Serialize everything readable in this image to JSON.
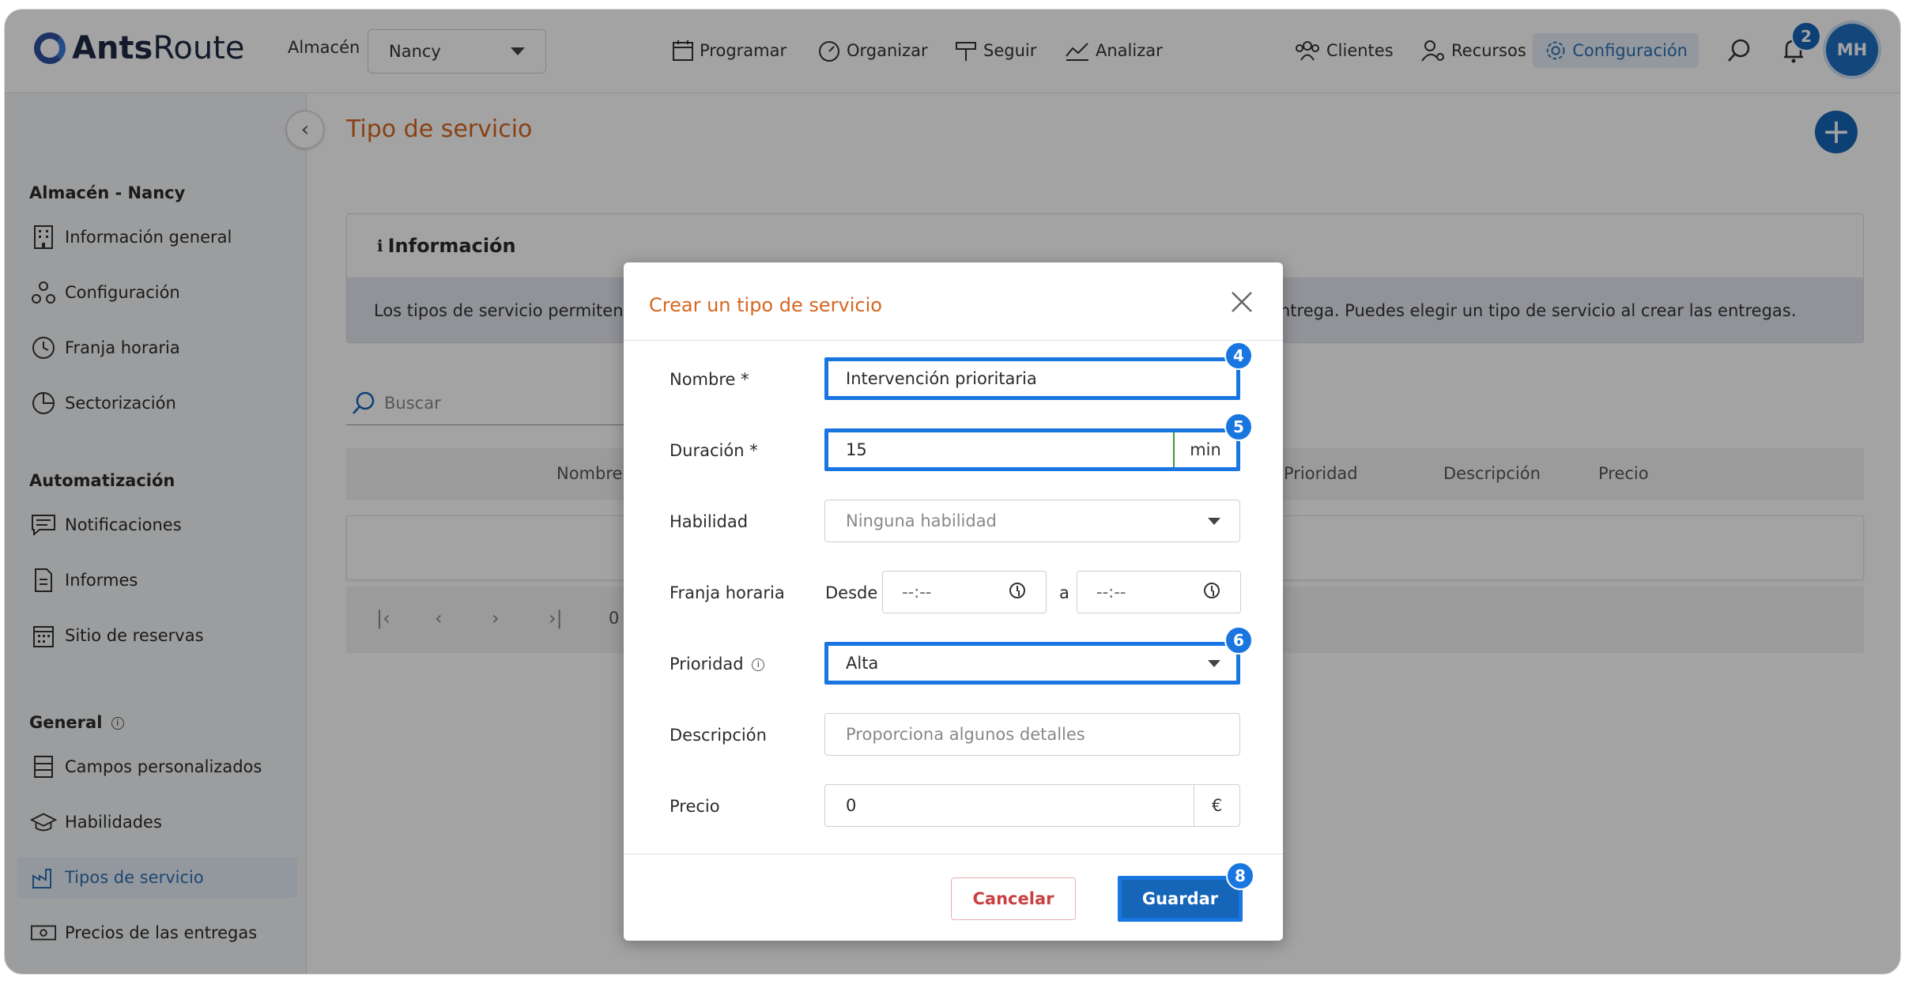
{
  "header": {
    "logo_bold": "Ants",
    "logo_light": "Route",
    "warehouse_label": "Almacén",
    "warehouse_value": "Nancy",
    "nav": [
      "Programar",
      "Organizar",
      "Seguir",
      "Analizar"
    ],
    "nav_right": [
      "Clientes",
      "Recursos",
      "Configuración"
    ],
    "notifications_count": "2",
    "avatar_initials": "MH"
  },
  "sidebar": {
    "section1": "Almacén - Nancy",
    "items1": [
      "Información general",
      "Configuración",
      "Franja horaria",
      "Sectorización"
    ],
    "section2": "Automatización",
    "items2": [
      "Notificaciones",
      "Informes",
      "Sitio de reservas"
    ],
    "section3": "General",
    "items3": [
      "Campos personalizados",
      "Habilidades",
      "Tipos de servicio",
      "Precios de las entregas"
    ],
    "active_item": "Tipos de servicio"
  },
  "main": {
    "page_title": "Tipo de servicio",
    "info_title": "Información",
    "info_text_left": "Los tipos de servicio permiten d",
    "info_text_right": "ntrega. Puedes elegir un tipo de servicio al crear las entregas.",
    "search_placeholder": "Buscar",
    "columns": [
      "Nombre",
      "Prioridad",
      "Descripción",
      "Precio"
    ],
    "pager_text": "0 /"
  },
  "modal": {
    "title": "Crear un tipo de servicio",
    "name_label": "Nombre *",
    "name_value": "Intervención prioritaria",
    "duration_label": "Duración *",
    "duration_value": "15",
    "duration_unit": "min",
    "skill_label": "Habilidad",
    "skill_value": "Ninguna habilidad",
    "timeslot_label": "Franja horaria",
    "from_label": "Desde",
    "from_value": "--:--",
    "to_label": "a",
    "to_value": "--:--",
    "priority_label": "Prioridad",
    "priority_value": "Alta",
    "description_label": "Descripción",
    "description_placeholder": "Proporciona algunos detalles",
    "price_label": "Precio",
    "price_value": "0",
    "currency": "€",
    "cancel_label": "Cancelar",
    "save_label": "Guardar"
  },
  "step_badges": [
    "4",
    "5",
    "6",
    "8"
  ],
  "colors": {
    "accent": "#1565b8",
    "title_orange": "#d6661f",
    "highlight": "#1976e0"
  }
}
